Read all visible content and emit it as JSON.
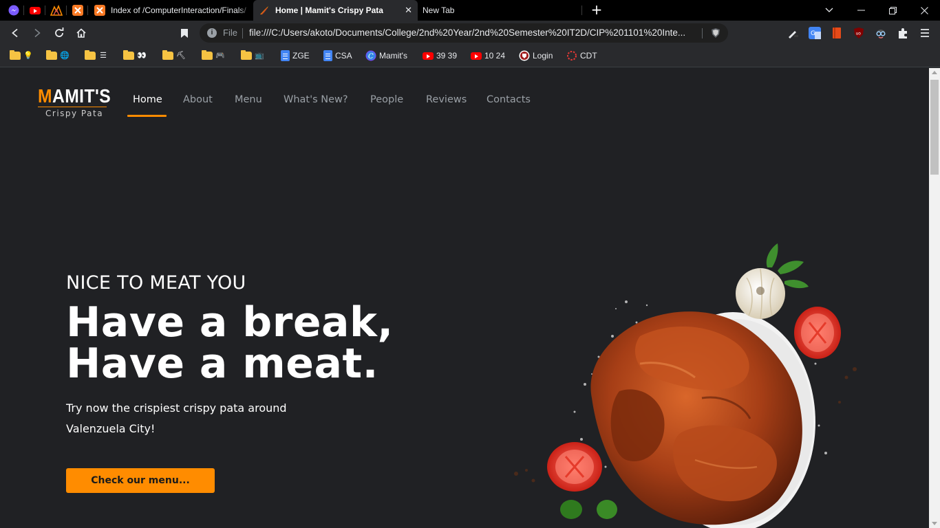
{
  "browser": {
    "tabs": [
      {
        "title": "Index of /ComputerInteraction/Finals/"
      },
      {
        "title": "Home | Mamit's Crispy Pata"
      },
      {
        "title": "New Tab"
      }
    ],
    "omnibox": {
      "scheme_label": "File",
      "url": "file:///C:/Users/akoto/Documents/College/2nd%20Year/2nd%20Semester%20IT2D/CIP%201101%20Inte..."
    },
    "bookmarks": [
      {
        "label": "ZGE"
      },
      {
        "label": "CSA"
      },
      {
        "label": "Mamit's"
      },
      {
        "label": "39 39"
      },
      {
        "label": "10 24"
      },
      {
        "label": "Login"
      },
      {
        "label": "CDT"
      }
    ],
    "colors": {
      "accent": "#ff8c00",
      "page_bg": "#202124",
      "tab_bg": "#000000",
      "toolbar_bg": "#292a2d"
    }
  },
  "site": {
    "logo": {
      "initial": "M",
      "rest": "AMIT'S",
      "subtitle": "Crispy Pata"
    },
    "nav": [
      {
        "label": "Home",
        "active": true
      },
      {
        "label": "About"
      },
      {
        "label": "Menu"
      },
      {
        "label": "What's New?"
      },
      {
        "label": "People"
      },
      {
        "label": "Reviews"
      },
      {
        "label": "Contacts"
      }
    ],
    "hero": {
      "eyebrow": "NICE TO MEAT YOU",
      "headline_line1": "Have a break,",
      "headline_line2": "Have a meat.",
      "subtext_line1": "Try now the crispiest crispy pata around",
      "subtext_line2": "Valenzuela City!",
      "cta_label": "Check our menu..."
    }
  }
}
